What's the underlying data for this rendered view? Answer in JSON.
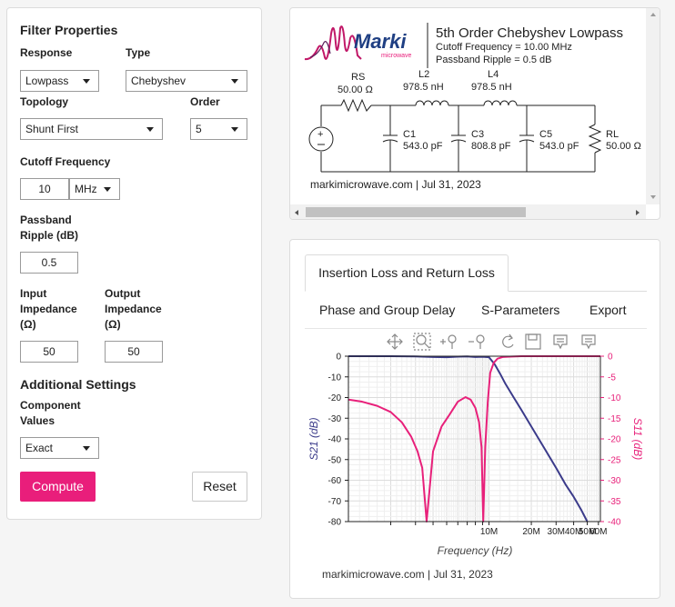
{
  "filter_panel": {
    "title": "Filter Properties",
    "response": {
      "label": "Response",
      "value": "Lowpass"
    },
    "type": {
      "label": "Type",
      "value": "Chebyshev"
    },
    "topology": {
      "label": "Topology",
      "value": "Shunt First"
    },
    "order": {
      "label": "Order",
      "value": "5"
    },
    "cutoff": {
      "label": "Cutoff Frequency",
      "value": "10",
      "unit": "MHz"
    },
    "ripple": {
      "label_line1": "Passband",
      "label_line2": "Ripple (dB)",
      "value": "0.5"
    },
    "input_impedance": {
      "label_line1": "Input",
      "label_line2": "Impedance",
      "label_line3": "(Ω)",
      "value": "50"
    },
    "output_impedance": {
      "label_line1": "Output",
      "label_line2": "Impedance",
      "label_line3": "(Ω)",
      "value": "50"
    },
    "additional_title": "Additional Settings",
    "component_values": {
      "label_line1": "Component",
      "label_line2": "Values",
      "value": "Exact"
    },
    "compute_label": "Compute",
    "reset_label": "Reset"
  },
  "schematic": {
    "logo_text": "Marki",
    "logo_subtext": "microwave",
    "title": "5th Order Chebyshev Lowpass",
    "cutoff_text": "Cutoff Frequency = 10.00 MHz",
    "ripple_text": "Passband Ripple = 0.5 dB",
    "rs": {
      "name": "RS",
      "value": "50.00 Ω"
    },
    "l2": {
      "name": "L2",
      "value": "978.5 nH"
    },
    "l4": {
      "name": "L4",
      "value": "978.5 nH"
    },
    "c1": {
      "name": "C1",
      "value": "543.0 pF"
    },
    "c3": {
      "name": "C3",
      "value": "808.8 pF"
    },
    "c5": {
      "name": "C5",
      "value": "543.0 pF"
    },
    "rl": {
      "name": "RL",
      "value": "50.00 Ω"
    },
    "footer": "markimicrowave.com | Jul 31, 2023"
  },
  "plot_panel": {
    "tabs": [
      "Insertion Loss and Return Loss",
      "Phase and Group Delay",
      "S-Parameters",
      "Export"
    ],
    "footer": "markimicrowave.com  |  Jul 31, 2023"
  },
  "colors": {
    "accent": "#e91e7b",
    "s21": "#3b3b8a",
    "s11": "#e8207a"
  },
  "chart_data": {
    "type": "line",
    "xlabel": "Frequency (Hz)",
    "ylabel": "S21 (dB)",
    "y2label": "S11 (dB)",
    "x_scale": "log",
    "xlim": [
      1000000,
      62000000
    ],
    "ylim": [
      -80,
      0
    ],
    "y2lim": [
      -40,
      0
    ],
    "x_tick_labels": [
      "10M",
      "20M",
      "30M",
      "40M",
      "50M",
      "60M"
    ],
    "x_tick_values": [
      10000000,
      20000000,
      30000000,
      40000000,
      50000000,
      60000000
    ],
    "y_ticks": [
      0,
      -10,
      -20,
      -30,
      -40,
      -50,
      -60,
      -70,
      -80
    ],
    "y2_ticks": [
      0,
      -5,
      -10,
      -15,
      -20,
      -25,
      -30,
      -35,
      -40
    ],
    "grid": true,
    "series": [
      {
        "name": "S21 (dB)",
        "axis": "left",
        "color": "#3b3b8a",
        "x": [
          1000000,
          2000000,
          3000000,
          4000000,
          5000000,
          6000000,
          7000000,
          8000000,
          9000000,
          10000000,
          11000000,
          12000000,
          13000000,
          15000000,
          17000000,
          20000000,
          25000000,
          30000000,
          35000000,
          40000000,
          45000000,
          50000000
        ],
        "y": [
          0,
          0,
          -0.1,
          -0.4,
          -0.5,
          -0.2,
          -0.1,
          -0.4,
          -0.3,
          -0.5,
          -4,
          -8.5,
          -13,
          -20,
          -26,
          -34,
          -45,
          -54,
          -62,
          -68,
          -74,
          -80
        ]
      },
      {
        "name": "S11 (dB)",
        "axis": "right",
        "color": "#e8207a",
        "x": [
          1000000,
          1250000,
          1600000,
          2000000,
          2400000,
          2800000,
          3100000,
          3350000,
          3600000,
          4000000,
          4600000,
          5200000,
          6000000,
          6800000,
          7400000,
          8000000,
          8500000,
          8850000,
          9100000,
          9400000,
          9800000,
          10200000,
          10800000,
          11500000,
          12500000,
          14000000,
          17000000,
          20000000,
          30000000,
          40000000,
          50000000,
          62000000
        ],
        "y": [
          -10.5,
          -11,
          -12,
          -13.5,
          -16,
          -19.5,
          -23,
          -27,
          -40,
          -23,
          -17,
          -14.3,
          -11,
          -9.9,
          -10.5,
          -12.5,
          -16,
          -22,
          -40,
          -22,
          -11,
          -4,
          -1.6,
          -0.6,
          -0.2,
          -0.1,
          0,
          0,
          0,
          0,
          0,
          0
        ]
      }
    ]
  },
  "chart_footer": "markimicrowave.com  |  Jul 31, 2023"
}
